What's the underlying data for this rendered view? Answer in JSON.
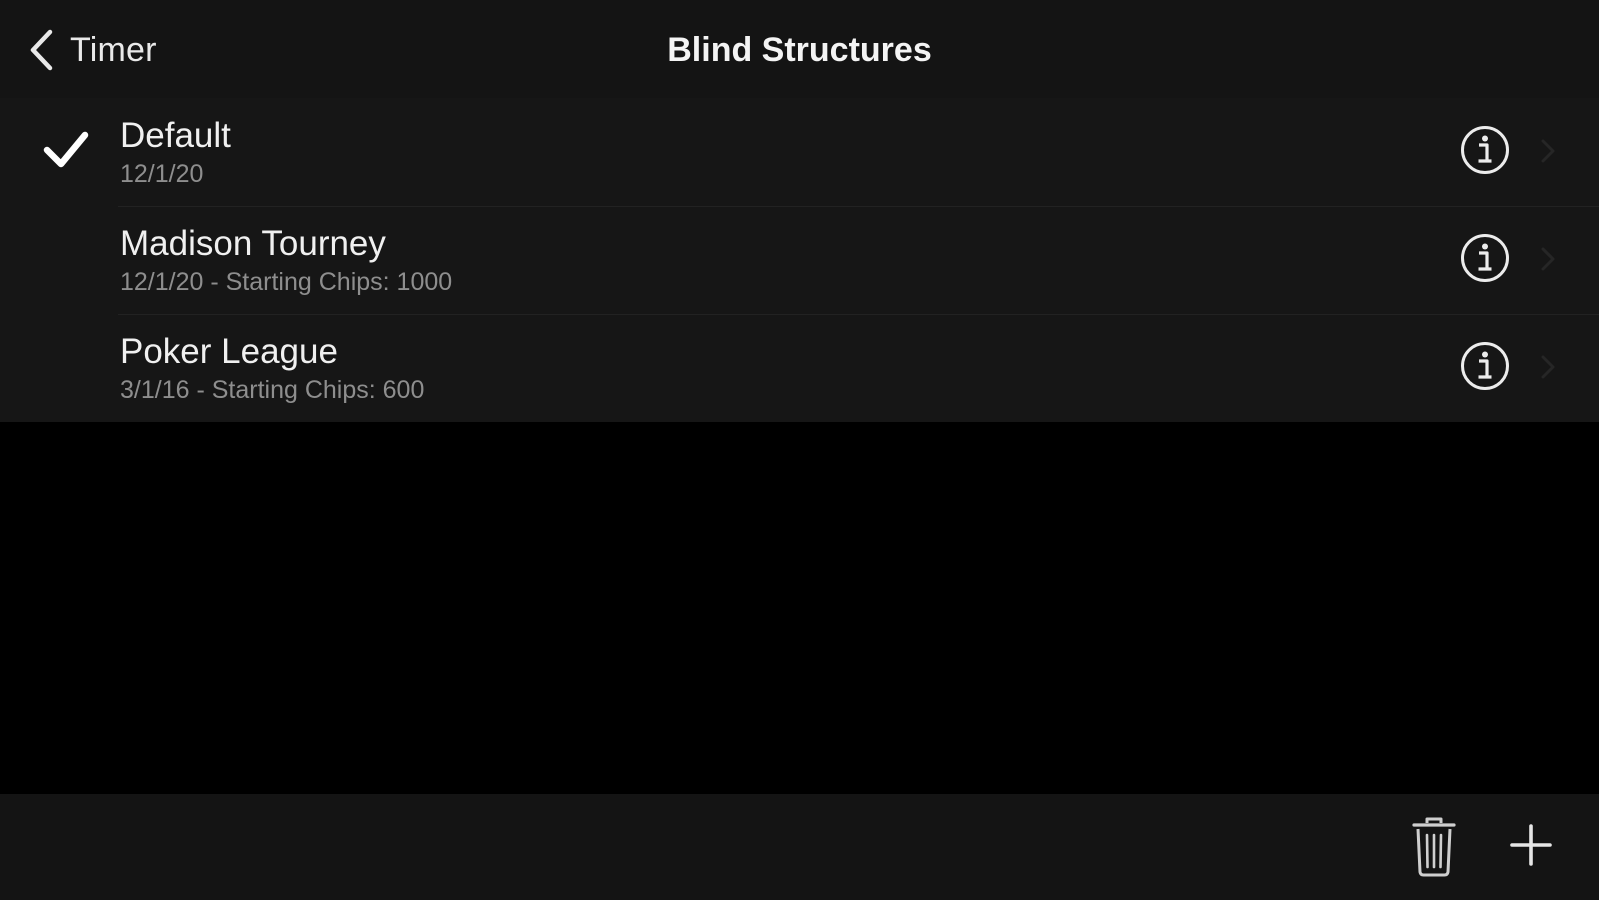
{
  "navbar": {
    "back_label": "Timer",
    "title": "Blind Structures"
  },
  "structures": [
    {
      "title": "Default",
      "subtitle": "12/1/20",
      "selected": true
    },
    {
      "title": "Madison Tourney",
      "subtitle": "12/1/20 - Starting Chips: 1000",
      "selected": false
    },
    {
      "title": "Poker League",
      "subtitle": "3/1/16 - Starting Chips: 600",
      "selected": false
    }
  ],
  "icons": {
    "back": "chevron-left-icon",
    "selected": "checkmark-icon",
    "info": "info-circle-icon",
    "disclosure": "chevron-right-icon",
    "delete": "trash-icon",
    "add": "plus-icon"
  },
  "colors": {
    "background": "#000000",
    "bar": "#141414",
    "row": "#161616",
    "text": "#f0f0f0",
    "subtext": "#8e8e8e"
  }
}
